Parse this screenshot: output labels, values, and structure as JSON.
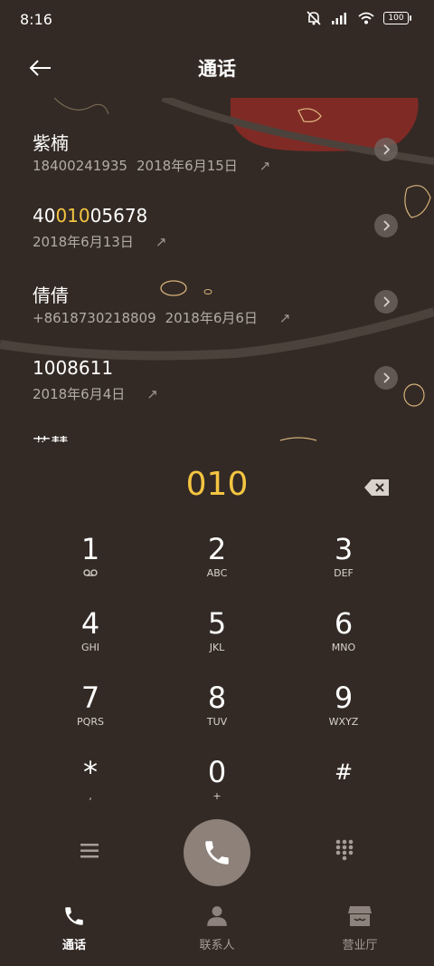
{
  "status_bar": {
    "time": "8:16",
    "battery": "100"
  },
  "header": {
    "title": "通话"
  },
  "calls": [
    {
      "name": "紫楠",
      "number": "18400241935",
      "date": "2018年6月15日"
    },
    {
      "name_prefix": "40",
      "name_highlight": "010",
      "name_suffix": "05678",
      "date": "2018年6月13日"
    },
    {
      "name": "倩倩",
      "number": "+8618730218809",
      "date": "2018年6月6日"
    },
    {
      "name": "1008611",
      "date": "2018年6月4日"
    },
    {
      "name": "花慧"
    }
  ],
  "dialer": {
    "input": "010"
  },
  "keypad": [
    {
      "num": "1",
      "sub": "voicemail-icon"
    },
    {
      "num": "2",
      "sub": "ABC"
    },
    {
      "num": "3",
      "sub": "DEF"
    },
    {
      "num": "4",
      "sub": "GHI"
    },
    {
      "num": "5",
      "sub": "JKL"
    },
    {
      "num": "6",
      "sub": "MNO"
    },
    {
      "num": "7",
      "sub": "PQRS"
    },
    {
      "num": "8",
      "sub": "TUV"
    },
    {
      "num": "9",
      "sub": "WXYZ"
    },
    {
      "num": "*",
      "sub": ","
    },
    {
      "num": "0",
      "sub": "+"
    },
    {
      "num": "#",
      "sub": ""
    }
  ],
  "bottom_nav": [
    {
      "label": "通话",
      "icon": "phone-icon",
      "active": true
    },
    {
      "label": "联系人",
      "icon": "person-icon",
      "active": false
    },
    {
      "label": "营业厅",
      "icon": "store-icon",
      "active": false
    }
  ],
  "colors": {
    "background": "#332a25",
    "highlight": "#f5c542",
    "call_button": "#8d817a"
  }
}
